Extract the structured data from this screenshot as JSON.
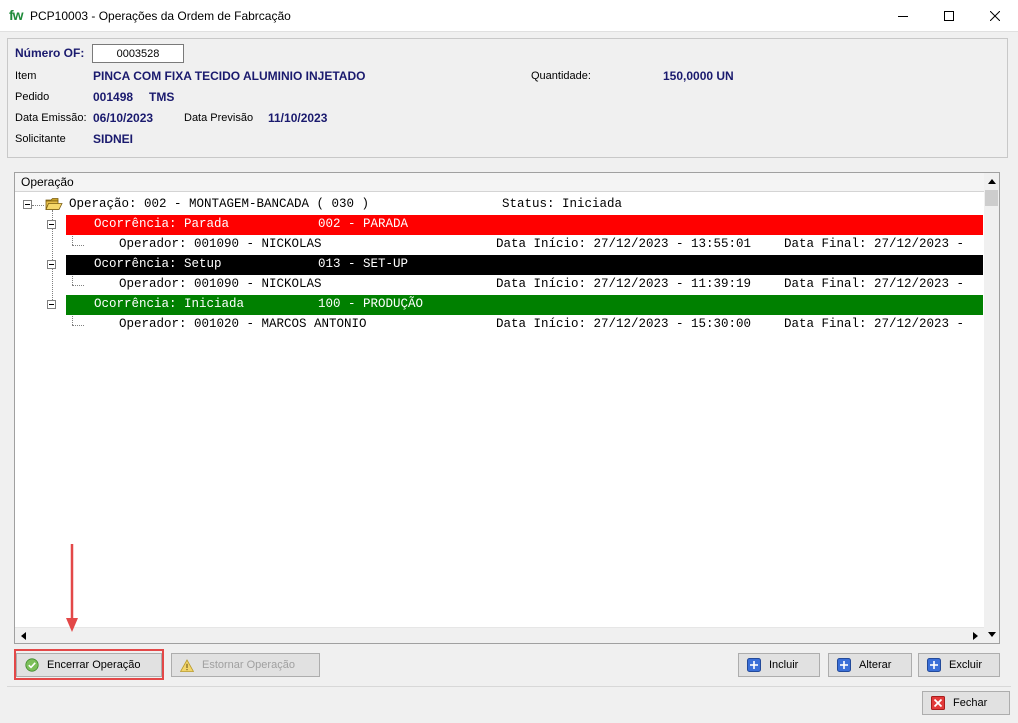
{
  "window": {
    "logo": "fw",
    "title": "PCP10003 - Operações da Ordem de Fabrcação"
  },
  "header": {
    "numero_of_label": "Número OF:",
    "numero_of_value": "0003528",
    "item_label": "Item",
    "item_value": "PINCA COM FIXA TECIDO ALUMINIO INJETADO",
    "quantidade_label": "Quantidade:",
    "quantidade_value": "150,0000 UN",
    "pedido_label": "Pedido",
    "pedido_value": "001498",
    "pedido_extra": "TMS",
    "data_emissao_label": "Data Emissão:",
    "data_emissao_value": "06/10/2023",
    "data_previsao_label": "Data Previsão",
    "data_previsao_value": "11/10/2023",
    "solicitante_label": "Solicitante",
    "solicitante_value": "SIDNEI"
  },
  "tree": {
    "column_header": "Operação",
    "operation": {
      "text": "Operação: 002 - MONTAGEM-BANCADA ( 030 )",
      "status": "Status: Iniciada"
    },
    "occurrences": [
      {
        "label": "Ocorrência: Parada",
        "code": "002 - PARADA",
        "color": "#ff0000",
        "operator": "Operador: 001090 - NICKOLAS",
        "inicio": "Data Início: 27/12/2023 - 13:55:01",
        "final": "Data Final: 27/12/2023 -"
      },
      {
        "label": "Ocorrência: Setup",
        "code": "013 - SET-UP",
        "color": "#000000",
        "operator": "Operador: 001090 - NICKOLAS",
        "inicio": "Data Início: 27/12/2023 - 11:39:19",
        "final": "Data Final: 27/12/2023 -"
      },
      {
        "label": "Ocorrência: Iniciada",
        "code": "100 - PRODUÇÃO",
        "color": "#008000",
        "operator": "Operador: 001020 - MARCOS ANTONIO",
        "inicio": "Data Início: 27/12/2023 - 15:30:00",
        "final": "Data Final: 27/12/2023 -"
      }
    ]
  },
  "buttons": {
    "encerrar": "Encerrar Operação",
    "estornar": "Estornar Operação",
    "incluir": "Incluir",
    "alterar": "Alterar",
    "excluir": "Excluir",
    "fechar": "Fechar"
  }
}
